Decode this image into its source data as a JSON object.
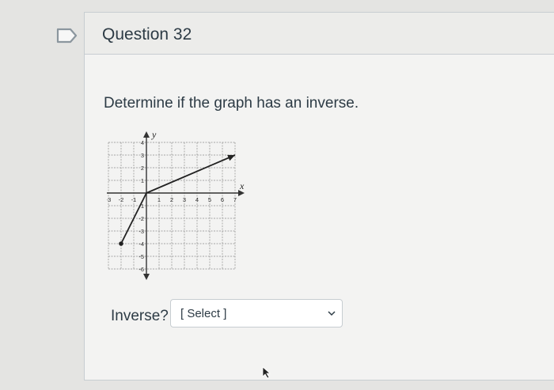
{
  "question": {
    "title": "Question 32",
    "prompt": "Determine if the graph has an inverse.",
    "answer_label": "Inverse?",
    "select": {
      "value": "[ Select ]",
      "options": [
        "[ Select ]"
      ]
    }
  },
  "graph": {
    "x_axis_label": "x",
    "y_axis_label": "y",
    "x_tick_labels": [
      "-3",
      "-2",
      "-1",
      "1",
      "2",
      "3",
      "4",
      "5",
      "6",
      "7"
    ],
    "y_tick_labels": [
      "4",
      "3",
      "2",
      "1",
      "-1",
      "-2",
      "-3",
      "-4",
      "-5",
      "-6"
    ],
    "xlim": [
      -3,
      7
    ],
    "ylim": [
      -6,
      4
    ],
    "grid": true,
    "segments": [
      {
        "points": [
          [
            -2,
            -4
          ],
          [
            0,
            0
          ]
        ],
        "start": "dot",
        "end": "none"
      },
      {
        "points": [
          [
            0,
            0
          ],
          [
            7,
            3
          ]
        ],
        "start": "none",
        "end": "arrow"
      }
    ]
  },
  "colors": {
    "background": "#e4e4e2",
    "card": "#f3f3f2",
    "border": "#c7cdd1",
    "text": "#2d3b45"
  },
  "icons": {
    "bookmark": "bookmark-flag-icon",
    "select_chevron": "chevron-down-icon",
    "cursor": "mouse-pointer-icon"
  }
}
